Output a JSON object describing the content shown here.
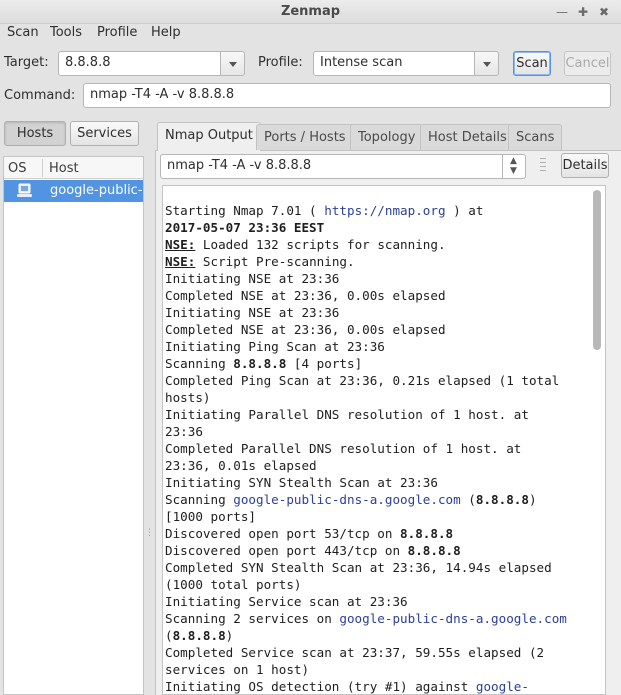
{
  "window": {
    "title": "Zenmap",
    "minimize_icon": "minimize-icon",
    "maximize_icon": "maximize-icon",
    "close_icon": "close-icon"
  },
  "menu": [
    "Scan",
    "Tools",
    "Profile",
    "Help"
  ],
  "toolbar": {
    "target_label": "Target:",
    "target_value": "8.8.8.8",
    "profile_label": "Profile:",
    "profile_value": "Intense scan",
    "scan_button": "Scan",
    "cancel_button": "Cancel",
    "command_label": "Command:",
    "command_value": "nmap -T4 -A -v 8.8.8.8"
  },
  "left_panel": {
    "hosts_button": "Hosts",
    "services_button": "Services",
    "columns": [
      "OS",
      "Host"
    ],
    "rows": [
      {
        "os_icon": "computer-icon",
        "host": "google-public-dns-a.google.com"
      }
    ]
  },
  "tabs": [
    "Nmap Output",
    "Ports / Hosts",
    "Topology",
    "Host Details",
    "Scans"
  ],
  "output_panel": {
    "command_select": "nmap -T4 -A -v 8.8.8.8",
    "details_button": "Details",
    "lines": [
      [
        {
          "t": "Starting Nmap 7.01 ( "
        },
        {
          "t": "https://nmap.org",
          "s": "lnk"
        },
        {
          "t": " ) at"
        }
      ],
      [
        {
          "t": "2017-05-07 23:36 EEST",
          "s": "b"
        }
      ],
      [
        {
          "t": "NSE:",
          "s": "u"
        },
        {
          "t": " Loaded 132 scripts for scanning."
        }
      ],
      [
        {
          "t": "NSE:",
          "s": "u"
        },
        {
          "t": " Script Pre-scanning."
        }
      ],
      [
        {
          "t": "Initiating NSE at 23:36"
        }
      ],
      [
        {
          "t": "Completed NSE at 23:36, 0.00s elapsed"
        }
      ],
      [
        {
          "t": "Initiating NSE at 23:36"
        }
      ],
      [
        {
          "t": "Completed NSE at 23:36, 0.00s elapsed"
        }
      ],
      [
        {
          "t": "Initiating Ping Scan at 23:36"
        }
      ],
      [
        {
          "t": "Scanning "
        },
        {
          "t": "8.8.8.8",
          "s": "b"
        },
        {
          "t": " [4 ports]"
        }
      ],
      [
        {
          "t": "Completed Ping Scan at 23:36, 0.21s elapsed (1 total"
        }
      ],
      [
        {
          "t": "hosts)"
        }
      ],
      [
        {
          "t": "Initiating Parallel DNS resolution of 1 host. at"
        }
      ],
      [
        {
          "t": "23:36"
        }
      ],
      [
        {
          "t": "Completed Parallel DNS resolution of 1 host. at"
        }
      ],
      [
        {
          "t": "23:36, 0.01s elapsed"
        }
      ],
      [
        {
          "t": "Initiating SYN Stealth Scan at 23:36"
        }
      ],
      [
        {
          "t": "Scanning "
        },
        {
          "t": "google-public-dns-a.google.com",
          "s": "lnk"
        },
        {
          "t": " ("
        },
        {
          "t": "8.8.8.8",
          "s": "b"
        },
        {
          "t": ")"
        }
      ],
      [
        {
          "t": "[1000 ports]"
        }
      ],
      [
        {
          "t": "Discovered open port 53/tcp on "
        },
        {
          "t": "8.8.8.8",
          "s": "b"
        }
      ],
      [
        {
          "t": "Discovered open port 443/tcp on "
        },
        {
          "t": "8.8.8.8",
          "s": "b"
        }
      ],
      [
        {
          "t": "Completed SYN Stealth Scan at 23:36, 14.94s elapsed"
        }
      ],
      [
        {
          "t": "(1000 total ports)"
        }
      ],
      [
        {
          "t": "Initiating Service scan at 23:36"
        }
      ],
      [
        {
          "t": "Scanning 2 services on "
        },
        {
          "t": "google-public-dns-a.google.com",
          "s": "lnk"
        }
      ],
      [
        {
          "t": "("
        },
        {
          "t": "8.8.8.8",
          "s": "b"
        },
        {
          "t": ")"
        }
      ],
      [
        {
          "t": "Completed Service scan at 23:37, 59.55s elapsed (2"
        }
      ],
      [
        {
          "t": "services on 1 host)"
        }
      ],
      [
        {
          "t": "Initiating OS detection (try #1) against "
        },
        {
          "t": "google-",
          "s": "lnk"
        }
      ]
    ]
  },
  "colors": {
    "selection": "#5294e2",
    "link": "#2c3f9a"
  }
}
